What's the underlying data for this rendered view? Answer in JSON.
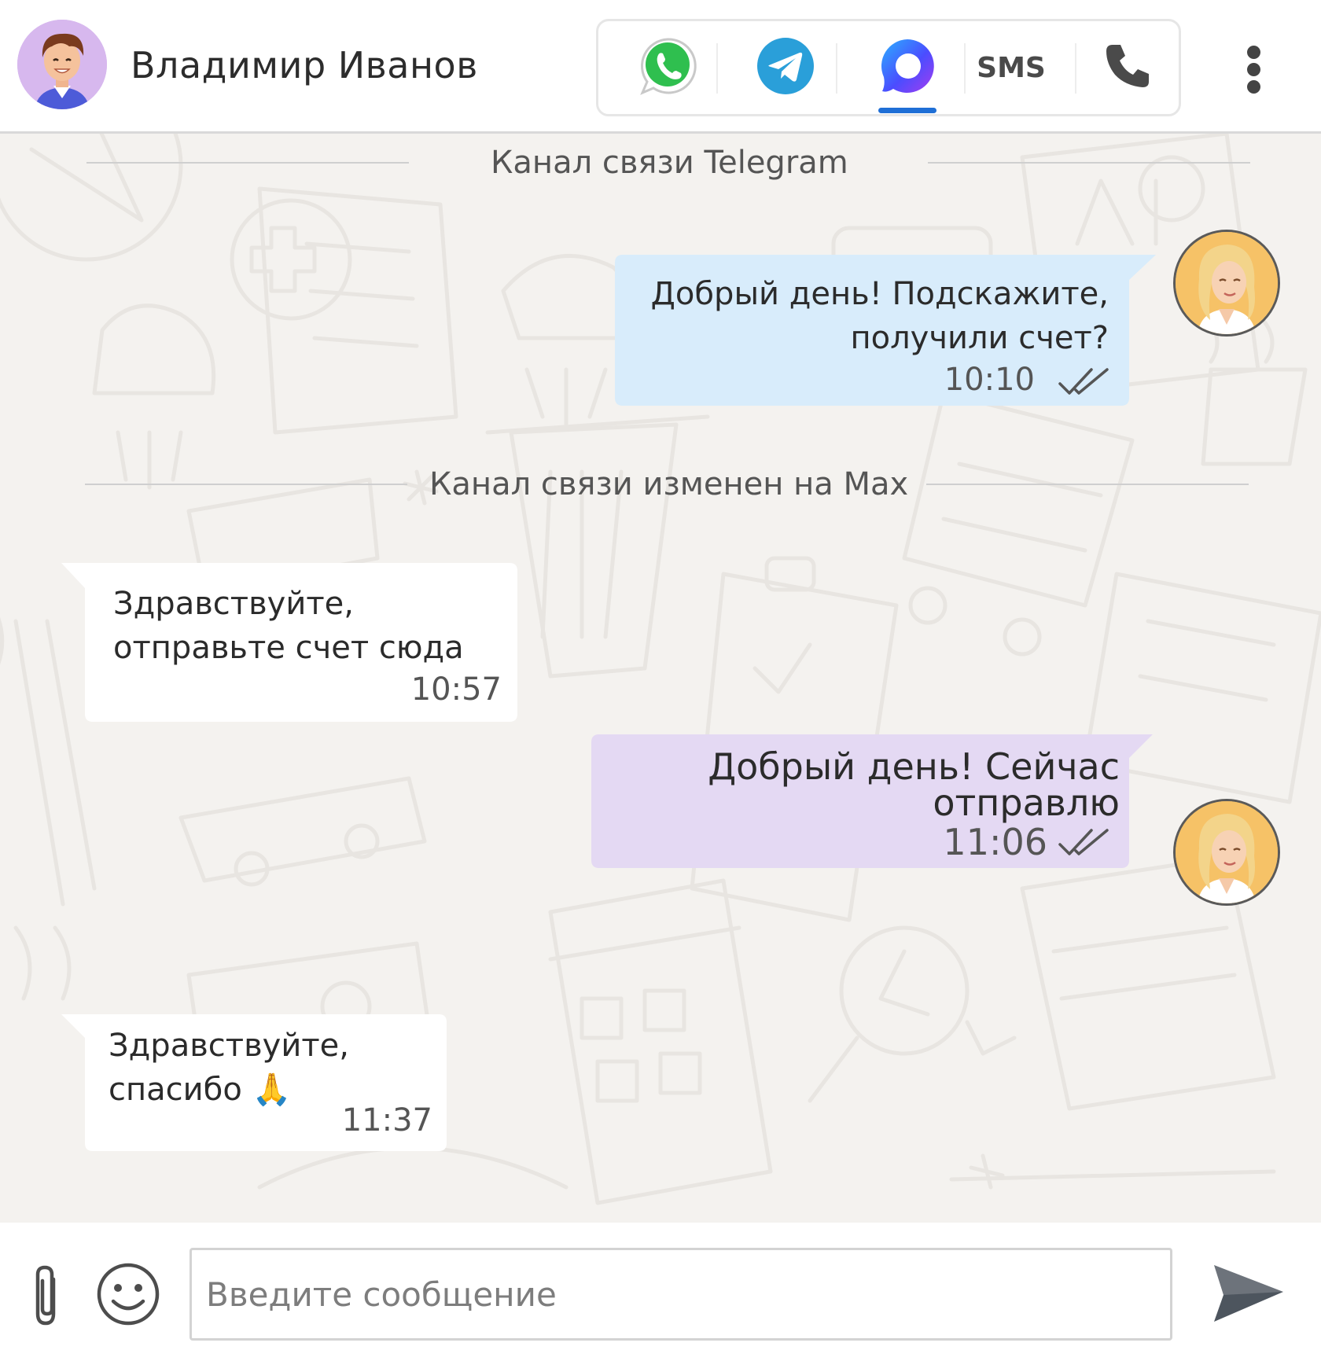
{
  "header": {
    "contact_name": "Владимир Иванов",
    "channels": [
      {
        "name": "whatsapp",
        "icon": "whatsapp-icon"
      },
      {
        "name": "telegram",
        "icon": "telegram-icon"
      },
      {
        "name": "max",
        "icon": "max-chat-icon",
        "active": true
      },
      {
        "name": "sms",
        "label": "SMS"
      },
      {
        "name": "phone",
        "icon": "phone-icon"
      }
    ],
    "menu_icon": "more-vertical-icon"
  },
  "colors": {
    "outgoing_telegram_bubble": "#d8ecfb",
    "outgoing_max_bubble": "#e4d9f3",
    "incoming_bubble": "#ffffff",
    "chat_background": "#f4f2ef",
    "active_channel_underline": "#1f6fd6"
  },
  "chat": {
    "separators": [
      {
        "text": "Канал связи Telegram"
      },
      {
        "text": "Канал связи изменен на Max"
      }
    ],
    "messages": [
      {
        "direction": "outgoing",
        "lines": [
          "Добрый день! Подскажите,",
          "получили счет?"
        ],
        "time": "10:10",
        "status": "double-check"
      },
      {
        "direction": "incoming",
        "lines": [
          "Здравствуйте,",
          "отправьте счет сюда"
        ],
        "time": "10:57"
      },
      {
        "direction": "outgoing",
        "lines": [
          "Добрый день! Сейчас",
          "отправлю"
        ],
        "time": "11:06",
        "status": "double-check"
      },
      {
        "direction": "incoming",
        "lines": [
          "Здравствуйте,",
          "спасибо 🙏"
        ],
        "time": "11:37"
      }
    ]
  },
  "composer": {
    "placeholder": "Введите сообщение",
    "attach_icon": "paperclip-icon",
    "emoji_icon": "smiley-icon",
    "send_icon": "send-icon"
  }
}
